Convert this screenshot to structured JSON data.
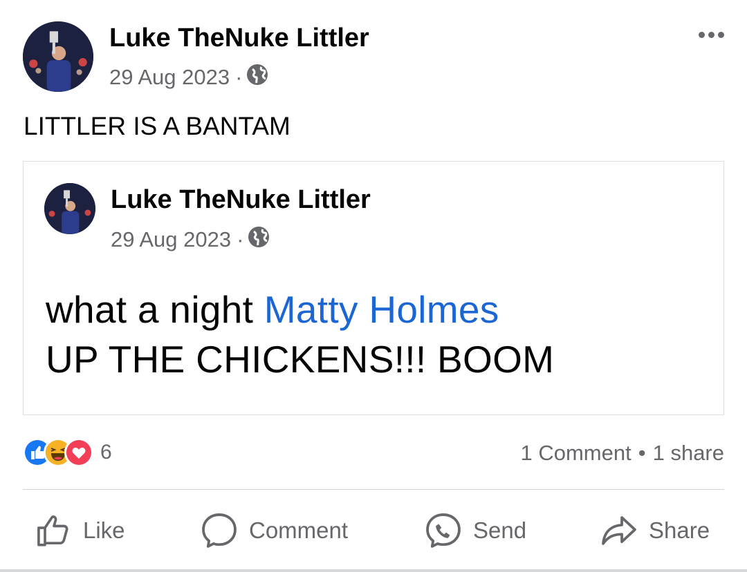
{
  "post": {
    "author": "Luke TheNuke Littler",
    "date": "29 Aug 2023",
    "separator": "·",
    "privacy_icon": "globe-icon",
    "menu_icon": "more-horizontal-icon",
    "text": "LITTLER IS A BANTAM"
  },
  "shared_post": {
    "author": "Luke TheNuke Littler",
    "date": "29 Aug 2023",
    "separator": "·",
    "privacy_icon": "globe-icon",
    "line1_prefix": "what a night ",
    "mention": "Matty Holmes",
    "line2": "UP THE CHICKENS!!! BOOM"
  },
  "engagement": {
    "reaction_icons": [
      "like-reaction-icon",
      "haha-reaction-icon",
      "love-reaction-icon"
    ],
    "reaction_count": "6",
    "comments": "1 Comment",
    "bullet": "•",
    "shares": "1 share"
  },
  "actions": {
    "like": "Like",
    "comment": "Comment",
    "send": "Send",
    "share": "Share"
  },
  "colors": {
    "text": "#050505",
    "secondary": "#65676b",
    "mention": "#1b66d2",
    "like_blue": "#1877f2",
    "love_red": "#f33e58",
    "haha_yellow": "#f7b125"
  }
}
